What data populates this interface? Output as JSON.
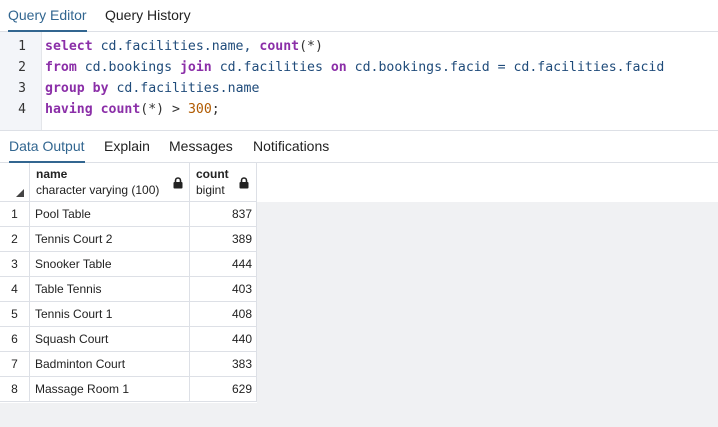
{
  "top_tabs": [
    {
      "label": "Query Editor",
      "active": true
    },
    {
      "label": "Query History",
      "active": false
    }
  ],
  "editor": {
    "lines": [
      {
        "number": "1",
        "tokens": [
          {
            "t": "select",
            "k": "kw"
          },
          {
            "t": " cd.facilities.name, ",
            "k": "id"
          },
          {
            "t": "count",
            "k": "kw"
          },
          {
            "t": "(*)",
            "k": "punct"
          }
        ]
      },
      {
        "number": "2",
        "tokens": [
          {
            "t": "from",
            "k": "kw"
          },
          {
            "t": " cd.bookings ",
            "k": "id"
          },
          {
            "t": "join",
            "k": "kw"
          },
          {
            "t": " cd.facilities ",
            "k": "id"
          },
          {
            "t": "on",
            "k": "kw"
          },
          {
            "t": " cd.bookings.facid = cd.facilities.facid",
            "k": "id"
          }
        ]
      },
      {
        "number": "3",
        "tokens": [
          {
            "t": "group by",
            "k": "kw"
          },
          {
            "t": " cd.facilities.name",
            "k": "id"
          }
        ]
      },
      {
        "number": "4",
        "tokens": [
          {
            "t": "having",
            "k": "kw"
          },
          {
            "t": " ",
            "k": "id"
          },
          {
            "t": "count",
            "k": "kw"
          },
          {
            "t": "(*) > ",
            "k": "punct"
          },
          {
            "t": "300",
            "k": "num"
          },
          {
            "t": ";",
            "k": "punct"
          }
        ]
      }
    ]
  },
  "bottom_tabs": [
    {
      "label": "Data Output",
      "active": true
    },
    {
      "label": "Explain",
      "active": false
    },
    {
      "label": "Messages",
      "active": false
    },
    {
      "label": "Notifications",
      "active": false
    }
  ],
  "grid": {
    "columns": [
      {
        "name": "name",
        "type": "character varying (100)",
        "locked_icon": "lock-icon"
      },
      {
        "name": "count",
        "type": "bigint",
        "locked_icon": "lock-icon"
      }
    ],
    "rows": [
      {
        "n": "1",
        "name": "Pool Table",
        "count": "837"
      },
      {
        "n": "2",
        "name": "Tennis Court 2",
        "count": "389"
      },
      {
        "n": "3",
        "name": "Snooker Table",
        "count": "444"
      },
      {
        "n": "4",
        "name": "Table Tennis",
        "count": "403"
      },
      {
        "n": "5",
        "name": "Tennis Court 1",
        "count": "408"
      },
      {
        "n": "6",
        "name": "Squash Court",
        "count": "440"
      },
      {
        "n": "7",
        "name": "Badminton Court",
        "count": "383"
      },
      {
        "n": "8",
        "name": "Massage Room 1",
        "count": "629"
      }
    ]
  },
  "colors": {
    "accent": "#326690",
    "keyword": "#8b2fa8",
    "identifier": "#1f4b7a",
    "number": "#b05a00"
  }
}
